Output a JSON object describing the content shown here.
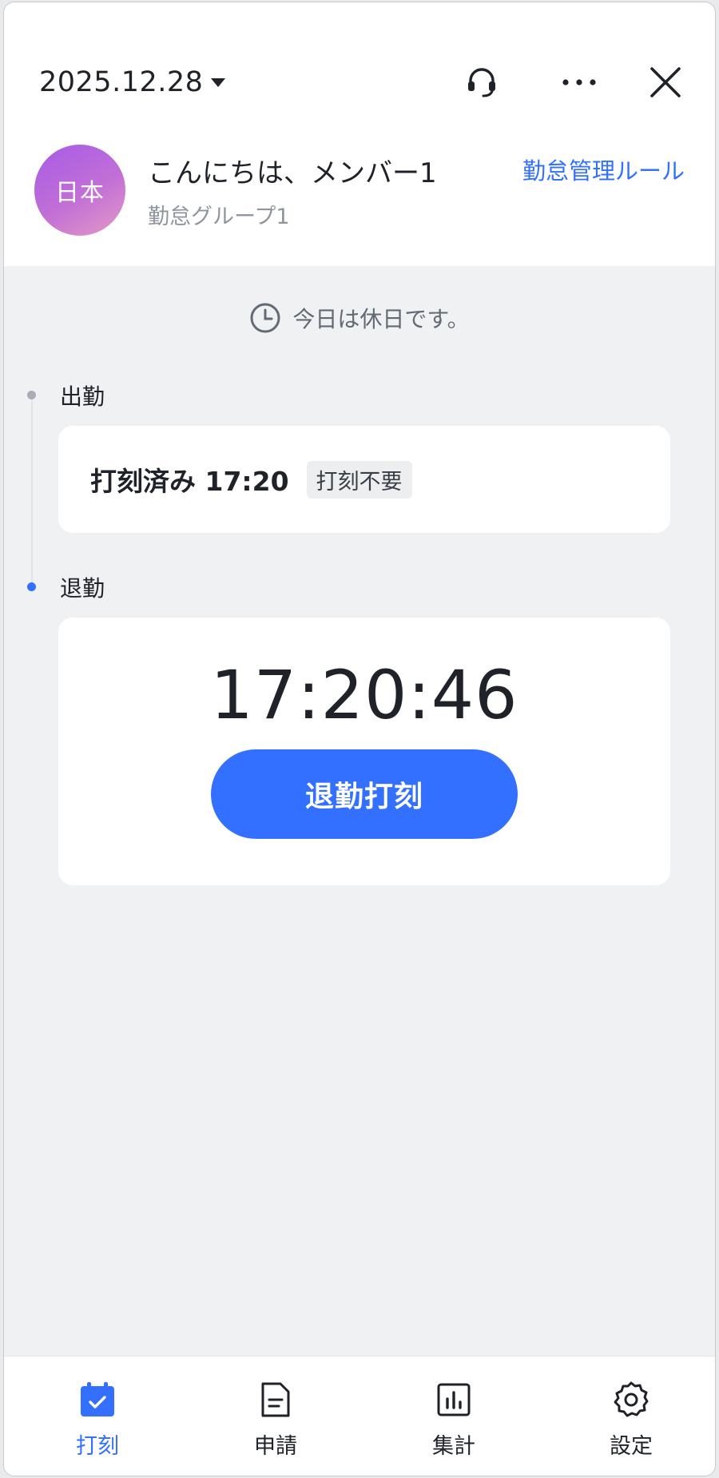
{
  "header": {
    "date": "2025.12.28",
    "greeting": "こんにちは、メンバー1",
    "group": "勤怠グループ1",
    "rules_link": "勤怠管理ルール",
    "avatar_text": "日本"
  },
  "status": {
    "holiday_message": "今日は休日です。"
  },
  "clock_in": {
    "label": "出勤",
    "checked_text": "打刻済み 17:20",
    "tag": "打刻不要"
  },
  "clock_out": {
    "label": "退勤",
    "current_time": "17:20:46",
    "button_label": "退勤打刻"
  },
  "tabs": [
    {
      "label": "打刻",
      "icon": "punch-calendar-icon",
      "active": true
    },
    {
      "label": "申請",
      "icon": "document-icon",
      "active": false
    },
    {
      "label": "集計",
      "icon": "bar-chart-icon",
      "active": false
    },
    {
      "label": "設定",
      "icon": "gear-icon",
      "active": false
    }
  ],
  "colors": {
    "accent": "#3370ff",
    "background": "#f0f1f3",
    "avatar_gradient_start": "#a65be6",
    "avatar_gradient_end": "#e59bc6"
  }
}
